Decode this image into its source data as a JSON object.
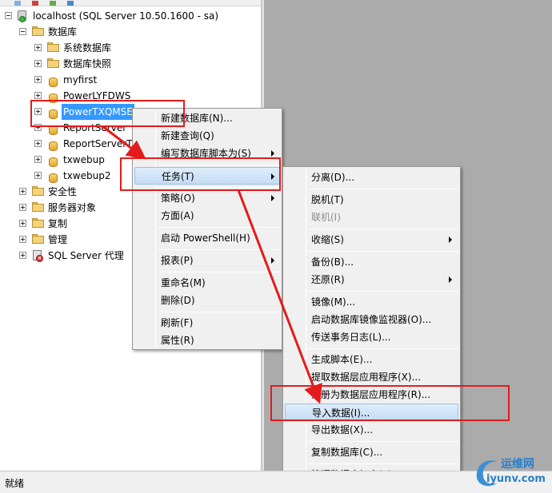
{
  "status_bar": {
    "text": "就绪"
  },
  "tree": {
    "server": "localhost (SQL Server 10.50.1600 - sa)",
    "databases": "数据库",
    "items": [
      "系统数据库",
      "数据库快照",
      "myfirst",
      "PowerLYFDWS",
      "PowerTXQMSE",
      "ReportServer",
      "ReportServerT",
      "txwebup",
      "txwebup2"
    ],
    "top_folders": [
      "安全性",
      "服务器对象",
      "复制",
      "管理"
    ],
    "agent": "SQL Server 代理"
  },
  "context_menu": {
    "items": [
      "新建数据库(N)...",
      "新建查询(Q)",
      "编写数据库脚本为(S)",
      "任务(T)",
      "策略(O)",
      "方面(A)",
      "启动 PowerShell(H)",
      "报表(P)",
      "重命名(M)",
      "删除(D)",
      "刷新(F)",
      "属性(R)"
    ]
  },
  "tasks_menu": {
    "items": [
      "分离(D)...",
      "脱机(T)",
      "联机(I)",
      "收缩(S)",
      "备份(B)...",
      "还原(R)",
      "镜像(M)...",
      "启动数据库镜像监视器(O)...",
      "传送事务日志(L)...",
      "生成脚本(E)...",
      "提取数据层应用程序(X)...",
      "注册为数据层应用程序(R)...",
      "导入数据(I)...",
      "导出数据(X)...",
      "复制数据库(C)...",
      "管理数据库加密(P)..."
    ]
  },
  "watermark": {
    "top": "运维网",
    "bottom": "iyunv.com"
  },
  "colors": {
    "annotation": "#e41b1b",
    "selection": "#3399ff",
    "menu_highlight": "#c4dcf4"
  }
}
